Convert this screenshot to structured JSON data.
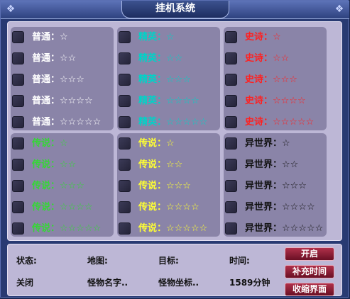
{
  "window": {
    "title": "挂机系统"
  },
  "panels": [
    {
      "id": "putong",
      "rows": [
        "普通：☆",
        "普通：☆☆",
        "普通：☆☆☆",
        "普通：☆☆☆☆",
        "普通：☆☆☆☆☆"
      ]
    },
    {
      "id": "jingying",
      "rows": [
        "精英：☆",
        "精英：☆☆",
        "精英：☆☆☆",
        "精英：☆☆☆☆",
        "精英：☆☆☆☆☆"
      ]
    },
    {
      "id": "shishi",
      "rows": [
        "史诗：☆",
        "史诗：☆☆",
        "史诗：☆☆☆",
        "史诗：☆☆☆☆",
        "史诗：☆☆☆☆☆"
      ]
    },
    {
      "id": "chuanshuo",
      "rows": [
        "传说：☆",
        "传说：☆☆",
        "传说：☆☆☆",
        "传说：☆☆☆☆",
        "传说：☆☆☆☆☆"
      ]
    },
    {
      "id": "chuanqi",
      "rows": [
        "传说：☆",
        "传说：☆☆",
        "传说：☆☆☆",
        "传说：☆☆☆☆",
        "传说：☆☆☆☆☆"
      ]
    },
    {
      "id": "yishijie",
      "rows": [
        "异世界：☆",
        "异世界：☆☆",
        "异世界：☆☆☆",
        "异世界：☆☆☆☆",
        "异世界：☆☆☆☆☆"
      ]
    }
  ],
  "status": {
    "state_label": "状态:",
    "map_label": "地图:",
    "target_label": "目标:",
    "time_label": "时间:",
    "state_value": "关闭",
    "map_value": "怪物名字..",
    "target_value": "怪物坐标..",
    "time_value": "1589分钟"
  },
  "buttons": {
    "start": "开启",
    "add_time": "补充时间",
    "collapse": "收缩界面"
  },
  "colors": {
    "putong": "#ffffff",
    "jingying": "#00d3c7",
    "shishi": "#ff2020",
    "chuanshuo": "#34d834",
    "chuanqi": "#ffff33",
    "yishijie": "#111111"
  }
}
